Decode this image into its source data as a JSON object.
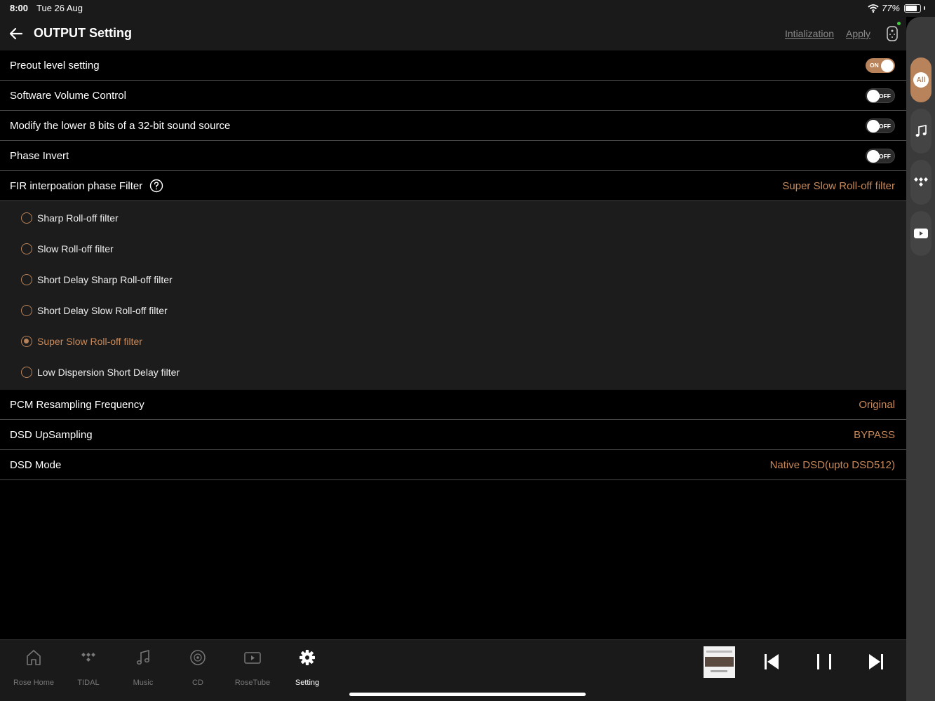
{
  "status": {
    "time": "8:00",
    "date": "Tue 26 Aug",
    "battery": "77%"
  },
  "header": {
    "title": "OUTPUT Setting",
    "init_label": "Intialization",
    "apply_label": "Apply"
  },
  "settings": {
    "preout": {
      "label": "Preout level setting",
      "toggle": "ON"
    },
    "software_volume": {
      "label": "Software Volume Control",
      "toggle": "OFF"
    },
    "modify_bits": {
      "label": "Modify the lower 8 bits of a 32-bit sound source",
      "toggle": "OFF"
    },
    "phase_invert": {
      "label": "Phase Invert",
      "toggle": "OFF"
    },
    "fir_filter": {
      "label": "FIR interpoation phase Filter",
      "value": "Super Slow Roll-off filter",
      "options": [
        "Sharp Roll-off filter",
        "Slow Roll-off filter",
        "Short Delay Sharp Roll-off filter",
        "Short Delay Slow Roll-off filter",
        "Super Slow Roll-off filter",
        "Low Dispersion Short Delay filter"
      ],
      "selected_index": 4
    },
    "pcm_resampling": {
      "label": "PCM Resampling Frequency",
      "value": "Original"
    },
    "dsd_upsampling": {
      "label": "DSD UpSampling",
      "value": "BYPASS"
    },
    "dsd_mode": {
      "label": "DSD Mode",
      "value": "Native DSD(upto DSD512)"
    }
  },
  "side_rail": {
    "all_label": "All"
  },
  "tabs": [
    {
      "label": "Rose Home",
      "icon": "home-icon"
    },
    {
      "label": "TIDAL",
      "icon": "tidal-icon"
    },
    {
      "label": "Music",
      "icon": "music-note-icon"
    },
    {
      "label": "CD",
      "icon": "cd-icon"
    },
    {
      "label": "RoseTube",
      "icon": "play-icon"
    },
    {
      "label": "Setting",
      "icon": "gear-icon"
    }
  ],
  "colors": {
    "accent": "#c8895a",
    "toggle_on": "#b8825a",
    "background": "#000000",
    "panel": "#1c1c1c"
  }
}
